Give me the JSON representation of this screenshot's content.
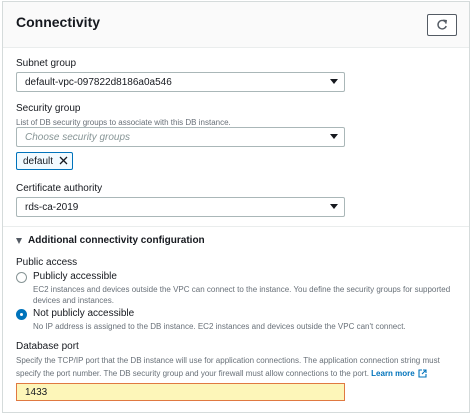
{
  "panel": {
    "title": "Connectivity",
    "refresh_icon": "refresh-icon"
  },
  "subnet_group": {
    "label": "Subnet group",
    "value": "default-vpc-097822d8186a0a546"
  },
  "security_group": {
    "label": "Security group",
    "description": "List of DB security groups to associate with this DB instance.",
    "placeholder": "Choose security groups",
    "tokens": [
      {
        "label": "default",
        "remove_icon": "close-icon"
      }
    ]
  },
  "certificate_authority": {
    "label": "Certificate authority",
    "value": "rds-ca-2019"
  },
  "additional_config": {
    "label": "Additional connectivity configuration",
    "expanded": true,
    "public_access": {
      "label": "Public access",
      "options": [
        {
          "label": "Publicly accessible",
          "description": "EC2 instances and devices outside the VPC can connect to the instance. You define the security groups for supported devices and instances.",
          "selected": false
        },
        {
          "label": "Not publicly accessible",
          "description": "No IP address is assigned to the DB instance. EC2 instances and devices outside the VPC can't connect.",
          "selected": true
        }
      ]
    },
    "database_port": {
      "label": "Database port",
      "description": "Specify the TCP/IP port that the DB instance will use for application connections. The application connection string must specify the port number. The DB security group and your firewall must allow connections to the port.",
      "learn_more": "Learn more",
      "learn_more_icon": "external-link-icon",
      "value": "1433"
    }
  },
  "colors": {
    "accent": "#0073bb",
    "highlight_fill": "#fdf6b9",
    "highlight_border": "#e07941"
  }
}
